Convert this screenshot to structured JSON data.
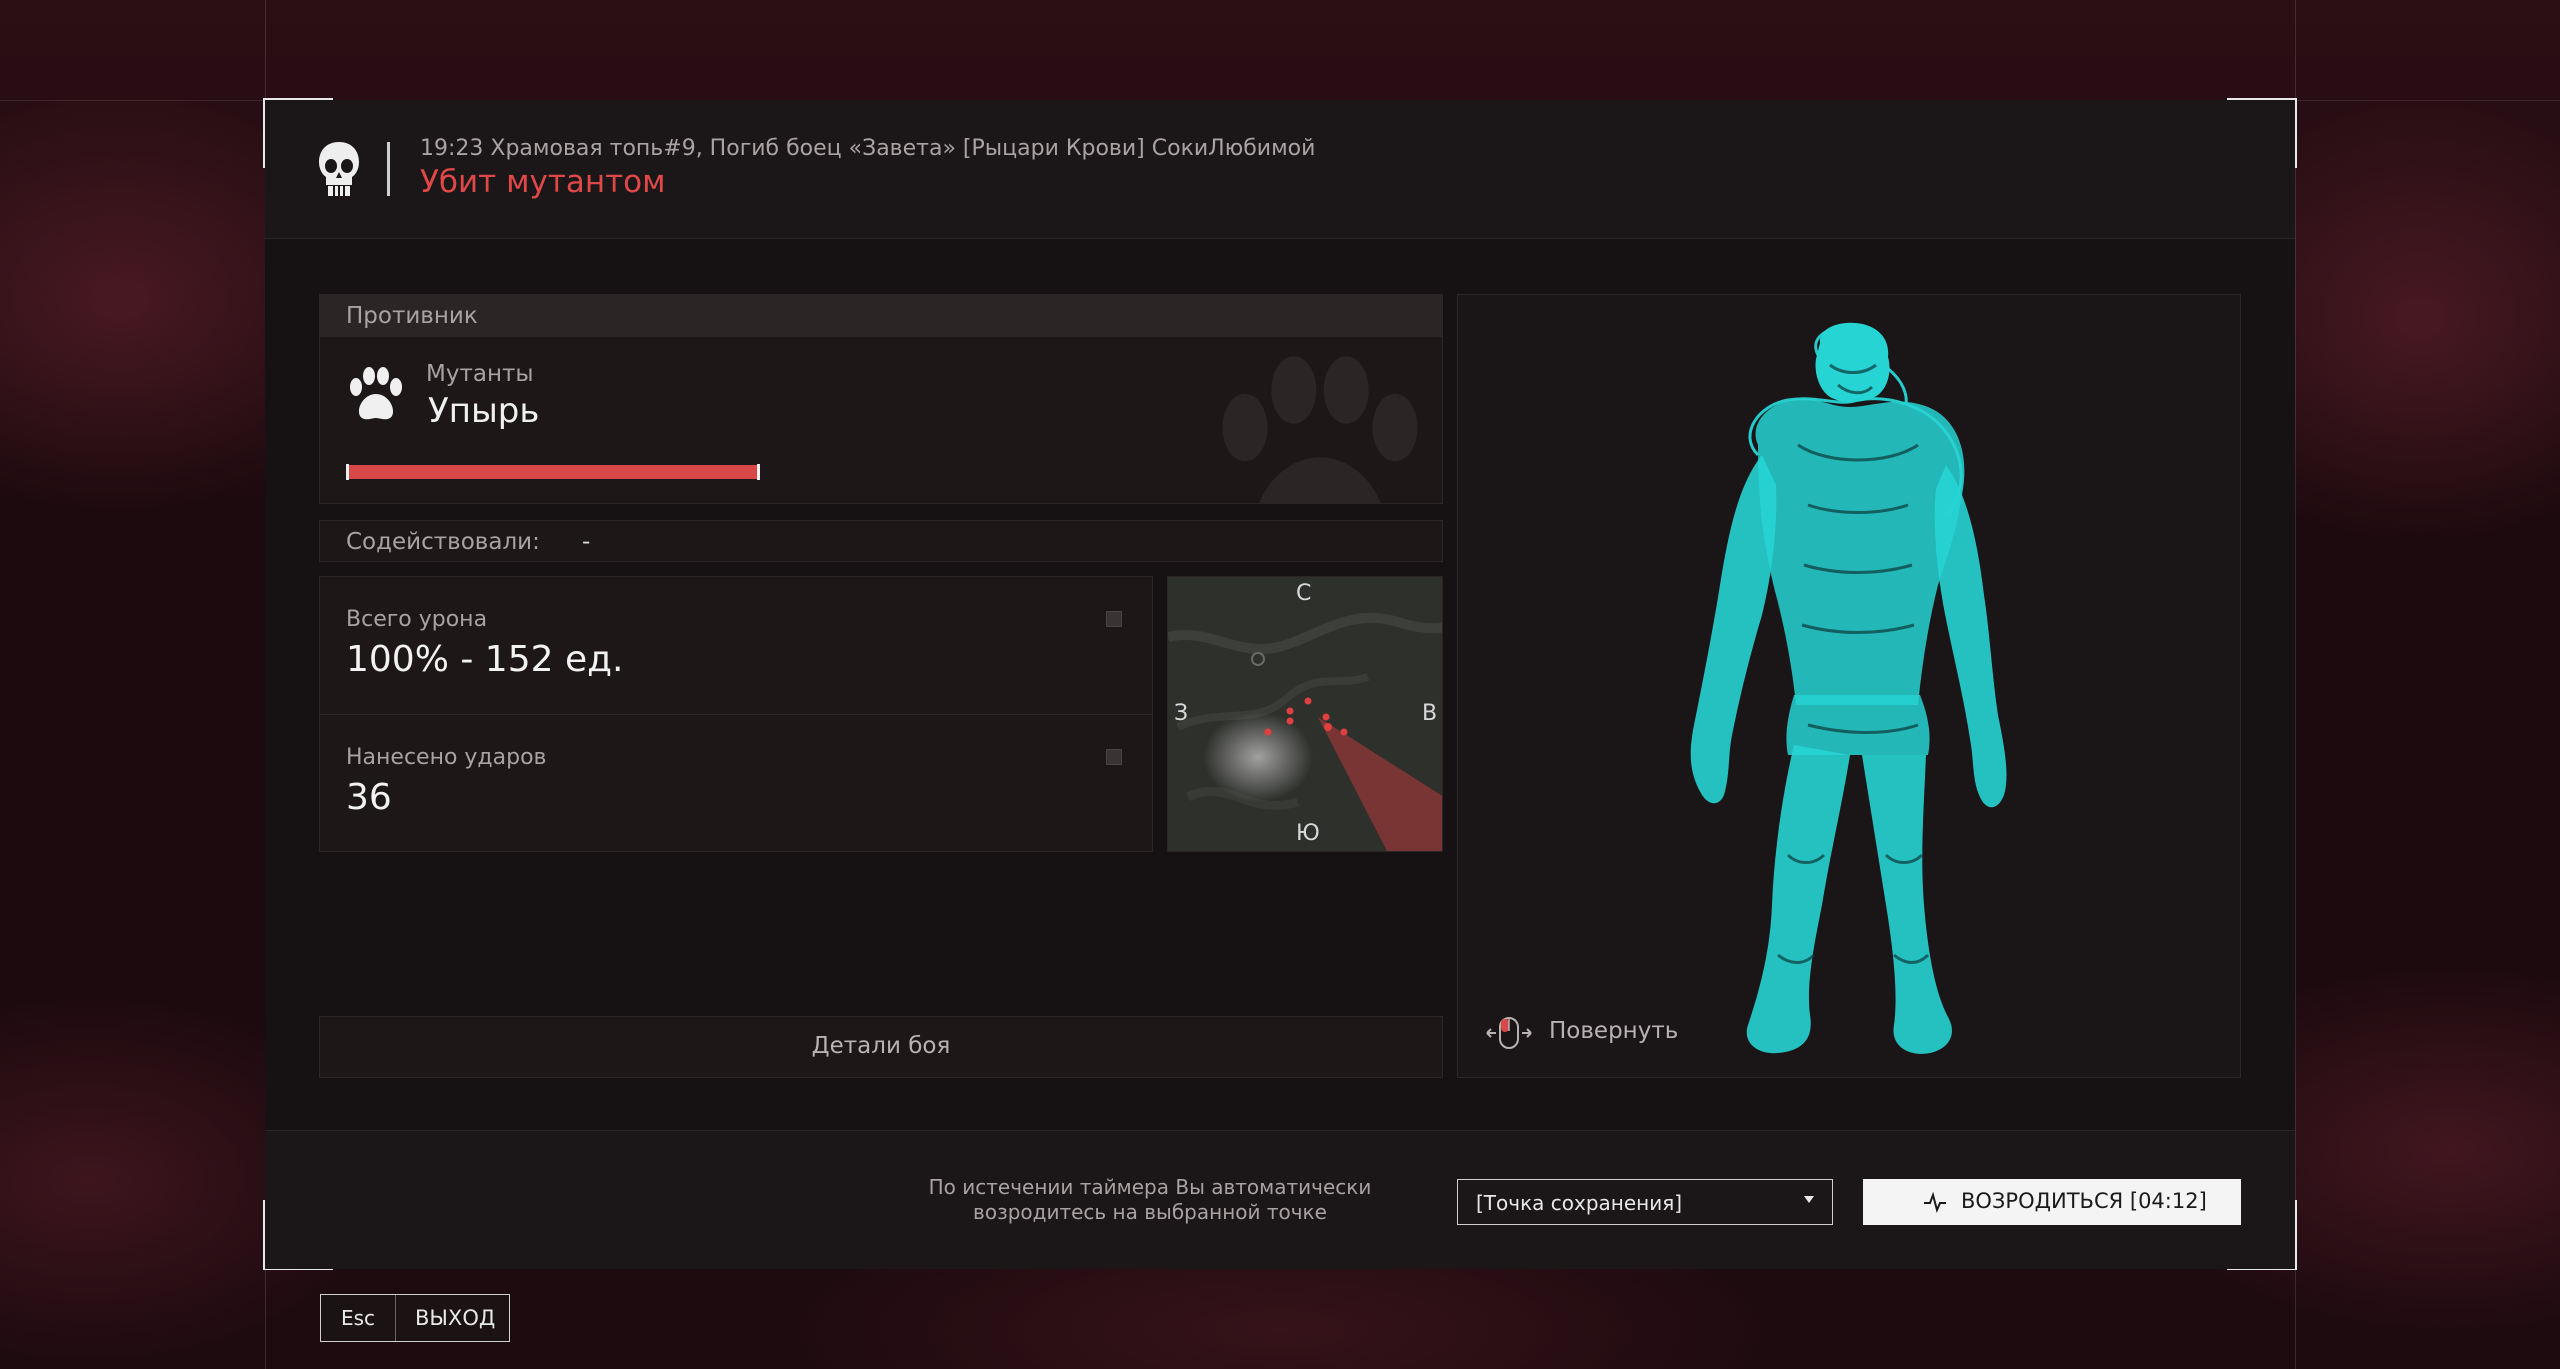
{
  "header": {
    "event_line": "19:23 Храмовая топь#9, Погиб боец «Завета» [Рыцари Крови] СокиЛюбимой",
    "title": "Убит мутантом"
  },
  "enemy": {
    "section_label": "Противник",
    "category": "Мутанты",
    "name": "Упырь",
    "health_fraction": 1.0,
    "icon": "paw-icon"
  },
  "assist": {
    "label": "Содействовали:",
    "value": "-"
  },
  "stats": {
    "total_damage_label": "Всего урона",
    "total_damage_value": "100% - 152 ед.",
    "hits_label": "Нанесено ударов",
    "hits_value": "36"
  },
  "minimap": {
    "north": "С",
    "south": "Ю",
    "west": "З",
    "east": "В"
  },
  "details_button": "Детали боя",
  "viewer": {
    "rotate_label": "Повернуть",
    "model_color": "#27d4d4"
  },
  "footer": {
    "notice_line1": "По истечении таймера Вы автоматически",
    "notice_line2": "возродитесь на выбранной точке",
    "spawn_select": "[Точка сохранения]",
    "respawn_button": "ВОЗРОДИТЬСЯ [04:12]"
  },
  "exit": {
    "key": "Esc",
    "label": "ВЫХОД"
  },
  "colors": {
    "accent_red": "#e04848",
    "hp_red": "#d84848",
    "model_cyan": "#27d4d4"
  }
}
